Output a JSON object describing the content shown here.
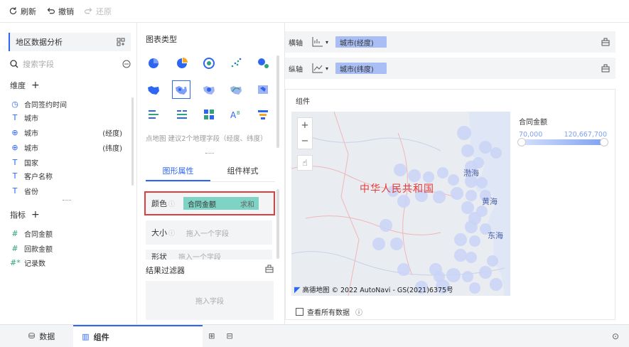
{
  "toolbar": {
    "refresh": "刷新",
    "undo": "撤销",
    "redo": "还原"
  },
  "left": {
    "dataset": "地区数据分析",
    "search_placeholder": "搜索字段",
    "dimension_title": "维度",
    "dimensions": [
      {
        "icon": "clock",
        "label": "合同签约时间",
        "suffix": ""
      },
      {
        "icon": "text",
        "label": "城市",
        "suffix": ""
      },
      {
        "icon": "globe",
        "label": "城市",
        "suffix": "(经度)"
      },
      {
        "icon": "globe",
        "label": "城市",
        "suffix": "(纬度)"
      },
      {
        "icon": "text",
        "label": "国家",
        "suffix": ""
      },
      {
        "icon": "text",
        "label": "客户名称",
        "suffix": ""
      },
      {
        "icon": "text",
        "label": "省份",
        "suffix": ""
      }
    ],
    "measure_title": "指标",
    "measures": [
      {
        "icon": "#",
        "label": "合同金额"
      },
      {
        "icon": "#",
        "label": "回款金额"
      },
      {
        "icon": "#*",
        "label": "记录数"
      }
    ]
  },
  "mid": {
    "chart_type_title": "图表类型",
    "chart_hint": "点地图 建议2个地理字段（经度、纬度）",
    "tabs": [
      "图形属性",
      "组件样式"
    ],
    "color_label": "颜色",
    "color_field": "合同金额",
    "color_agg": "求和",
    "size_label": "大小",
    "size_hint": "拖入一个字段",
    "shape_label": "形状",
    "shape_hint": "拖入一个字段",
    "filter_title": "结果过滤器",
    "filter_hint": "拖入字段"
  },
  "right": {
    "x_axis_label": "横轴",
    "x_axis_field": "城市(经度)",
    "y_axis_label": "纵轴",
    "y_axis_field": "城市(纬度)",
    "component_title": "组件",
    "legend_title": "合同金额",
    "legend_min": "70,000",
    "legend_max": "120,667,700",
    "map_labels": {
      "country": "中华人民共和国",
      "bohai": "渤海",
      "huanghai": "黄海",
      "donghai": "东海"
    },
    "zoom_in": "+",
    "zoom_out": "−",
    "copyright": "高德地图 © 2022 AutoNavi - GS(2021)6375号",
    "view_all": "查看所有数据"
  },
  "bottom": {
    "data_tab": "数据",
    "component_tab": "组件"
  },
  "colors": {
    "accent": "#2d66f2",
    "highlight": "#e23c3c",
    "chip": "#7ed3c4",
    "pill": "#a9bef5",
    "bubble": "#c9d4f6"
  }
}
